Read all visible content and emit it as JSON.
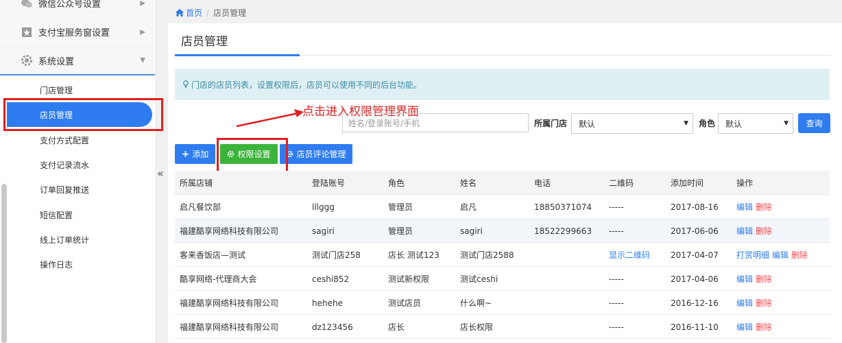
{
  "sidebar": {
    "menus": [
      {
        "label": "微信公众号设置"
      },
      {
        "label": "支付宝服务窗设置"
      },
      {
        "label": "系统设置"
      }
    ],
    "sub_items": [
      {
        "label": "门店管理"
      },
      {
        "label": "店员管理"
      },
      {
        "label": "支付方式配置"
      },
      {
        "label": "支付记录流水"
      },
      {
        "label": "订单回复推送"
      },
      {
        "label": "短信配置"
      },
      {
        "label": "线上订单统计"
      },
      {
        "label": "操作日志"
      }
    ],
    "collapse_glyph": "«"
  },
  "breadcrumb": {
    "home": "首页",
    "sep": "/",
    "current": "店员管理"
  },
  "page": {
    "title": "店员管理",
    "tip": "门店的店员列表，设置权限后，店员可以使用不同的后台功能。"
  },
  "filters": {
    "search_placeholder": "姓名/登录账号/手机",
    "store_label": "所属门店",
    "store_value": "默认",
    "role_label": "角色",
    "role_value": "默认",
    "query_label": "查询"
  },
  "annotation": "点击进入权限管理界面",
  "toolbar": {
    "add": "添加",
    "perm": "权限设置",
    "review": "店员评论管理"
  },
  "table": {
    "headers": [
      "所属店铺",
      "登陆账号",
      "角色",
      "姓名",
      "电话",
      "二维码",
      "添加时间",
      "操作"
    ],
    "rows": [
      {
        "store": "启凡餐饮部",
        "account": "lllggg",
        "role": "管理员",
        "name": "启凡",
        "phone": "18850371074",
        "qr": "-----",
        "date": "2017-08-16",
        "extra": "",
        "edit": "编辑",
        "delete": "删除"
      },
      {
        "store": "福建酷享网络科技有限公司",
        "account": "sagiri",
        "role": "管理员",
        "name": "sagiri",
        "phone": "18522299663",
        "qr": "-----",
        "date": "2017-06-06",
        "extra": "",
        "edit": "编辑",
        "delete": "删除"
      },
      {
        "store": "客来香饭店—测试",
        "account": "测试门店258",
        "role": "店长 测试123",
        "name": "测试门店2588",
        "phone": "",
        "qr": "显示二维码",
        "date": "2017-04-07",
        "extra": "打赏明细",
        "edit": "编辑",
        "delete": "删除"
      },
      {
        "store": "酷享网络-代理商大会",
        "account": "ceshi852",
        "role": "测试新权限",
        "name": "测试ceshi",
        "phone": "",
        "qr": "-----",
        "date": "2017-04-06",
        "extra": "",
        "edit": "编辑",
        "delete": "删除"
      },
      {
        "store": "福建酷享网络科技有限公司",
        "account": "hehehe",
        "role": "测试店员",
        "name": "什么啊~",
        "phone": "",
        "qr": "-----",
        "date": "2016-12-16",
        "extra": "",
        "edit": "编辑",
        "delete": "删除"
      },
      {
        "store": "福建酷享网络科技有限公司",
        "account": "dz123456",
        "role": "店长",
        "name": "店长权限",
        "phone": "",
        "qr": "-----",
        "date": "2016-11-10",
        "extra": "",
        "edit": "编辑",
        "delete": "删除"
      }
    ]
  },
  "colors": {
    "primary": "#2f7cf1",
    "green": "#3cb43c",
    "annotation": "#e01e1e",
    "delete": "#e94b4b"
  }
}
